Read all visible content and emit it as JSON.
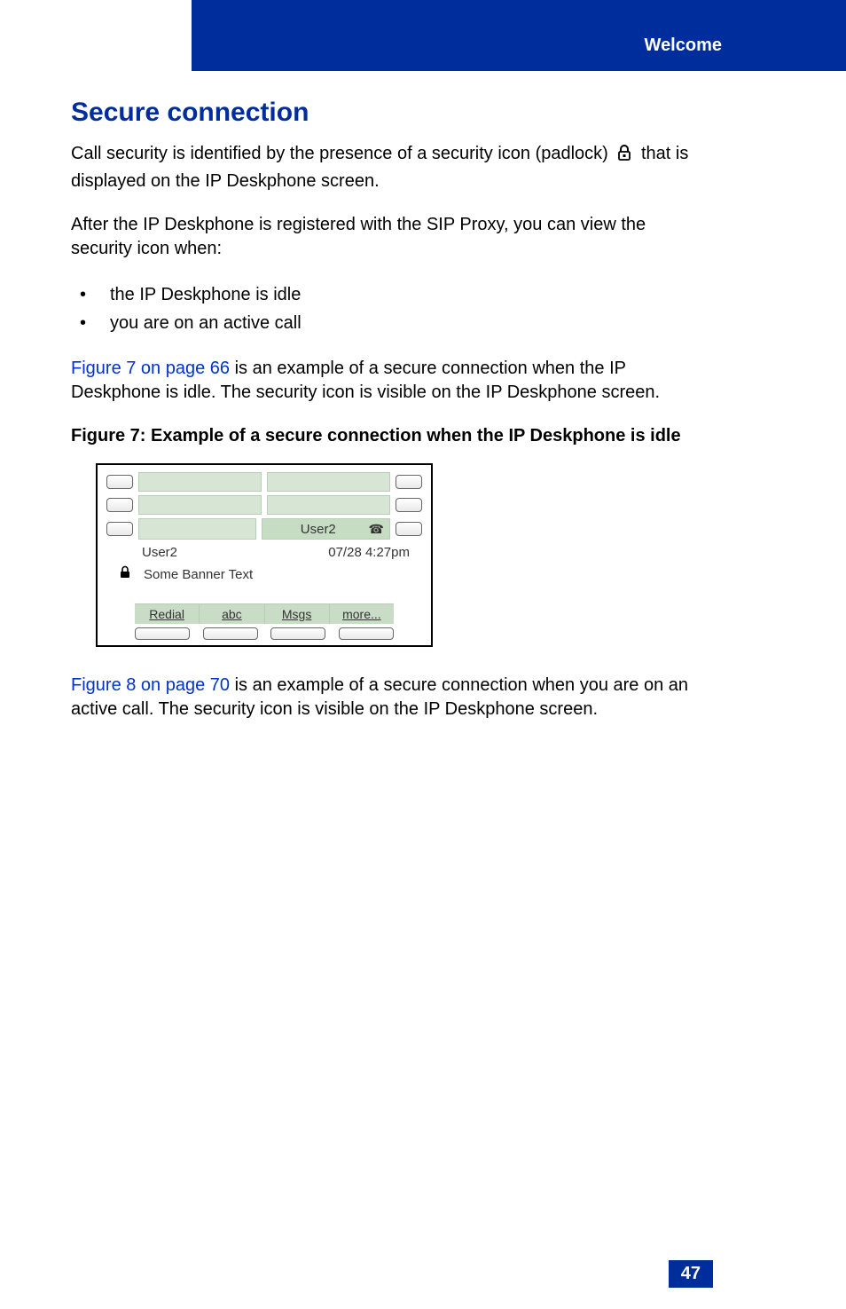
{
  "header": {
    "section": "Welcome"
  },
  "title": "Secure connection",
  "intro": {
    "line1_pre": "Call security is identified by the presence of a security icon (padlock)",
    "line1_post": "that is displayed on the IP Deskphone screen."
  },
  "after_reg": "After the IP Deskphone is registered with the SIP Proxy, you can view the security icon when:",
  "bullets": [
    "the IP Deskphone is idle",
    "you are on an active call"
  ],
  "para_fig7_ref": "Figure 7 on page 66",
  "para_fig7_rest": " is an example of a secure connection when the IP Deskphone is idle. The security icon is visible on the IP Deskphone screen.",
  "fig7_caption": "Figure 7: Example of a secure connection when the IP Deskphone is idle",
  "phone": {
    "title": "User2",
    "user": "User2",
    "datetime": "07/28 4:27pm",
    "banner": "Some Banner Text",
    "softkeys": [
      "Redial",
      "abc",
      "Msgs",
      "more..."
    ]
  },
  "para_fig8_ref": "Figure 8 on page 70",
  "para_fig8_rest": " is an example of a secure connection when you are on an active call. The security icon is visible on the IP Deskphone screen.",
  "page_number": "47"
}
